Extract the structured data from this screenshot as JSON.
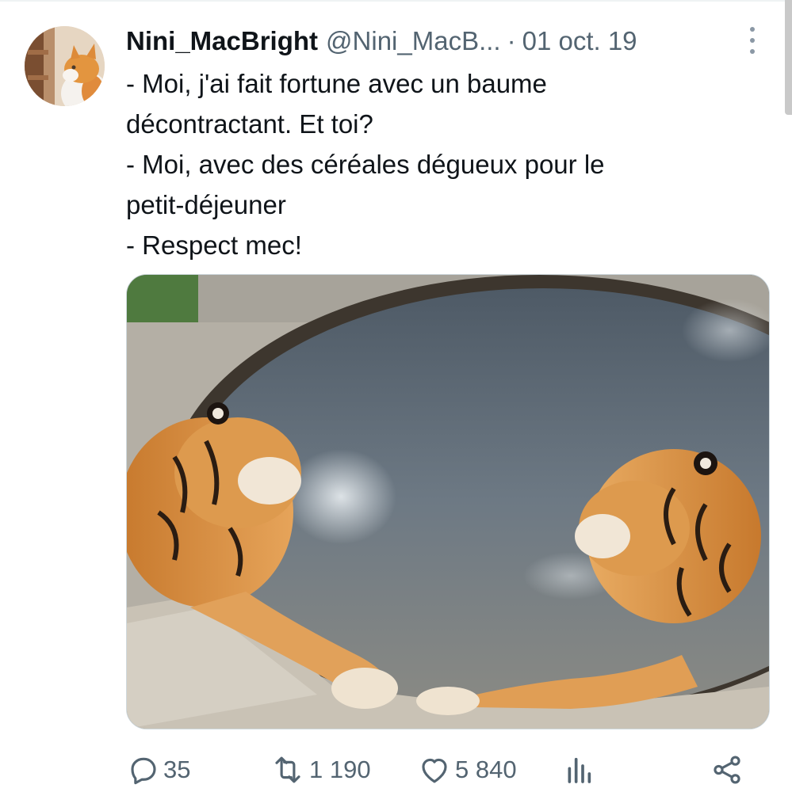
{
  "tweet": {
    "author_name": "Nini_MacBright",
    "author_handle": "@Nini_MacB...",
    "separator": "·",
    "date": "01 oct. 19",
    "text_lines": [
      "- Moi, j'ai fait fortune avec un baume",
      "décontractant. Et toi?",
      "- Moi, avec des céréales dégueux pour le",
      "petit-déjeuner",
      "- Respect mec!"
    ],
    "media_description_icon": "tigers-in-hot-tub-photo",
    "actions": {
      "replies": "35",
      "retweets": "1 190",
      "likes": "5 840"
    },
    "icons": {
      "avatar": "orange-cat-avatar",
      "more": "more-vertical-icon",
      "reply": "reply-bubble-icon",
      "retweet": "retweet-icon",
      "like": "heart-icon",
      "views": "analytics-icon",
      "share": "share-icon"
    },
    "colors": {
      "text_primary": "#0f1419",
      "text_secondary": "#536471"
    }
  }
}
